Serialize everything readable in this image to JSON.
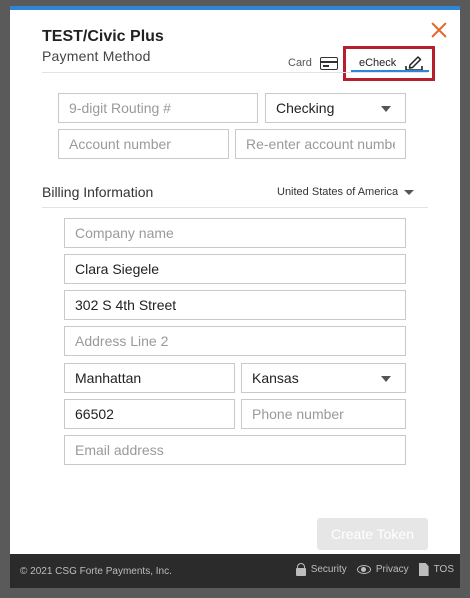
{
  "header": {
    "title": "TEST/Civic Plus",
    "subtitle": "Payment Method"
  },
  "tabs": {
    "card_label": "Card",
    "echeck_label": "eCheck",
    "active": "eCheck",
    "highlight_color": "#b51f2e",
    "accent_color": "#2f86d6"
  },
  "account": {
    "routing_placeholder": "9-digit Routing #",
    "account_type": "Checking",
    "account_number_placeholder": "Account number",
    "reenter_placeholder": "Re-enter account number"
  },
  "billing": {
    "title": "Billing Information",
    "country": "United States of America",
    "company_placeholder": "Company name",
    "name_value": "Clara Siegele",
    "address1_value": "302 S 4th Street",
    "address2_placeholder": "Address Line 2",
    "city_value": "Manhattan",
    "state_value": "Kansas",
    "zip_value": "66502",
    "phone_placeholder": "Phone number",
    "email_placeholder": "Email address"
  },
  "actions": {
    "create_token": "Create Token"
  },
  "footer": {
    "copyright": "© 2021 CSG Forte Payments, Inc.",
    "security": "Security",
    "privacy": "Privacy",
    "tos": "TOS"
  },
  "icons": {
    "close": "close-icon",
    "card": "credit-card-icon",
    "echeck": "check-signature-icon",
    "lock": "lock-icon",
    "eye": "eye-icon",
    "doc": "document-icon"
  }
}
